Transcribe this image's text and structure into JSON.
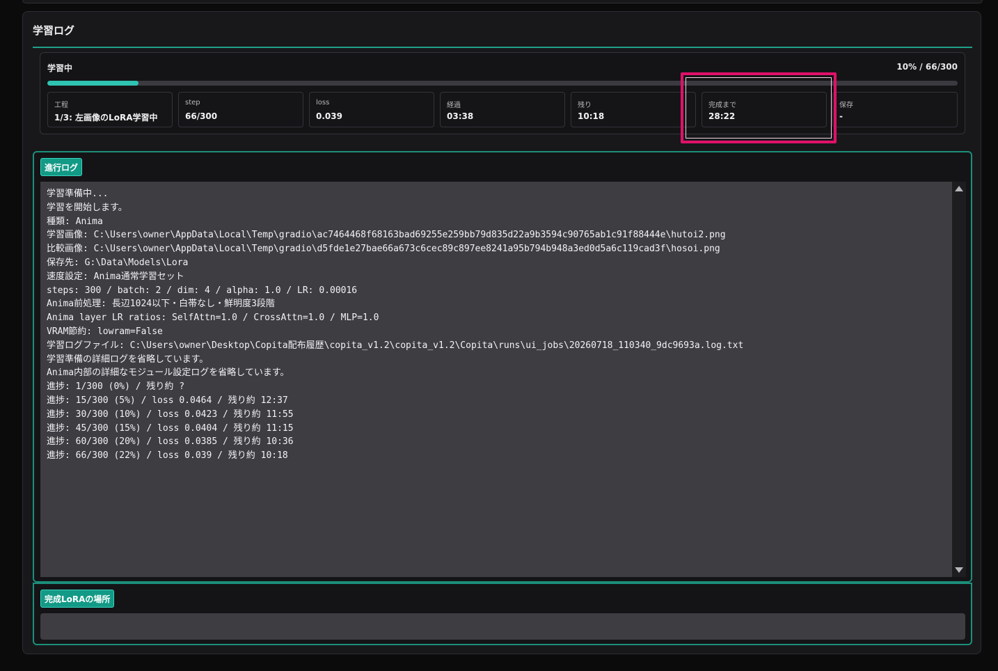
{
  "panel": {
    "title": "学習ログ"
  },
  "status": {
    "label": "学習中",
    "progress_text": "10% / 66/300",
    "progress_fraction": 0.1,
    "cards": [
      {
        "label": "工程",
        "value": "1/3: 左画像のLoRA学習中"
      },
      {
        "label": "step",
        "value": "66/300"
      },
      {
        "label": "loss",
        "value": "0.039"
      },
      {
        "label": "経過",
        "value": "03:38"
      },
      {
        "label": "残り",
        "value": "10:18"
      },
      {
        "label": "完成まで",
        "value": "28:22"
      },
      {
        "label": "保存",
        "value": "-"
      }
    ]
  },
  "log": {
    "tab_label": "進行ログ",
    "lines": [
      "学習準備中...",
      "学習を開始します。",
      "種類: Anima",
      "学習画像: C:\\Users\\owner\\AppData\\Local\\Temp\\gradio\\ac7464468f68163bad69255e259bb79d835d22a9b3594c90765ab1c91f88444e\\hutoi2.png",
      "比較画像: C:\\Users\\owner\\AppData\\Local\\Temp\\gradio\\d5fde1e27bae66a673c6cec89c897ee8241a95b794b948a3ed0d5a6c119cad3f\\hosoi.png",
      "保存先: G:\\Data\\Models\\Lora",
      "速度設定: Anima通常学習セット",
      "steps: 300 / batch: 2 / dim: 4 / alpha: 1.0 / LR: 0.00016",
      "Anima前処理: 長辺1024以下・白帯なし・鮮明度3段階",
      "Anima layer LR ratios: SelfAttn=1.0 / CrossAttn=1.0 / MLP=1.0",
      "VRAM節約: lowram=False",
      "学習ログファイル: C:\\Users\\owner\\Desktop\\Copita配布履歴\\copita_v1.2\\copita_v1.2\\Copita\\runs\\ui_jobs\\20260718_110340_9dc9693a.log.txt",
      "学習準備の詳細ログを省略しています。",
      "Anima内部の詳細なモジュール設定ログを省略しています。",
      "進捗: 1/300 (0%) / 残り約 ?",
      "進捗: 15/300 (5%) / loss 0.0464 / 残り約 12:37",
      "進捗: 30/300 (10%) / loss 0.0423 / 残り約 11:55",
      "進捗: 45/300 (15%) / loss 0.0404 / 残り約 11:15",
      "進捗: 60/300 (20%) / loss 0.0385 / 残り約 10:36",
      "進捗: 66/300 (22%) / loss 0.039 / 残り約 10:18"
    ]
  },
  "result": {
    "tab_label": "完成LoRAの場所",
    "value": ""
  },
  "colors": {
    "accent": "#1fa088",
    "highlight": "#e0106a",
    "progress": "#2fc4b2"
  }
}
